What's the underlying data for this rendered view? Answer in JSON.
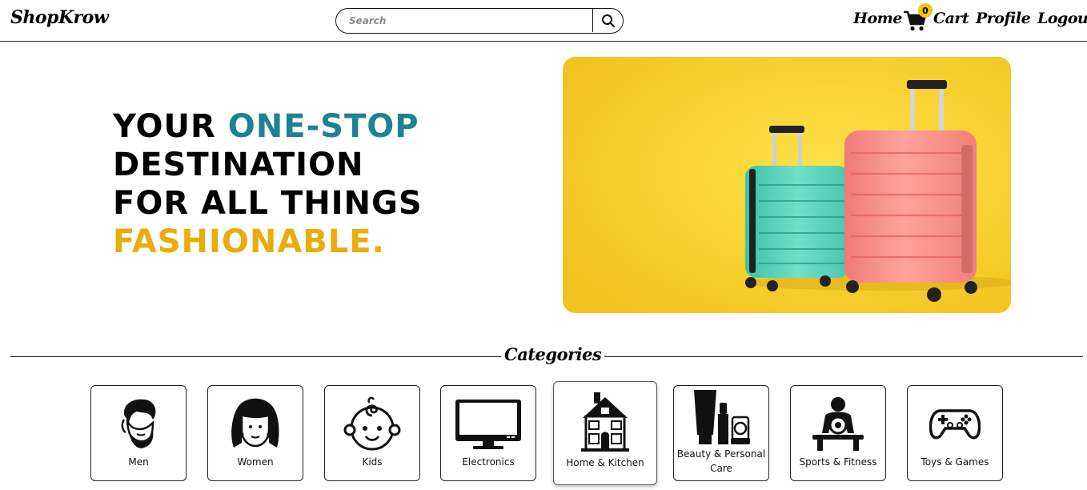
{
  "header": {
    "logo": "ShopKrow",
    "search_placeholder": "Search",
    "nav": {
      "home": "Home",
      "cart": "Cart",
      "cart_count": "0",
      "profile": "Profile",
      "logout": "Logout"
    }
  },
  "hero": {
    "line1_a": "YOUR ",
    "line1_b": "ONE-STOP",
    "line2": "DESTINATION",
    "line3": "FOR ALL THINGS",
    "line4": "FASHIONABLE."
  },
  "categories": {
    "title": "Categories",
    "items": [
      {
        "label": "Men"
      },
      {
        "label": "Women"
      },
      {
        "label": "Kids"
      },
      {
        "label": "Electronics"
      },
      {
        "label": "Home & Kitchen"
      },
      {
        "label": "Beauty & Personal Care"
      },
      {
        "label": "Sports & Fitness"
      },
      {
        "label": "Toys & Games"
      }
    ]
  },
  "colors": {
    "accent_teal": "#1d8291",
    "accent_gold": "#e8ad0c",
    "hero_bg": "#f7cc2c",
    "badge": "#f1c40f"
  }
}
